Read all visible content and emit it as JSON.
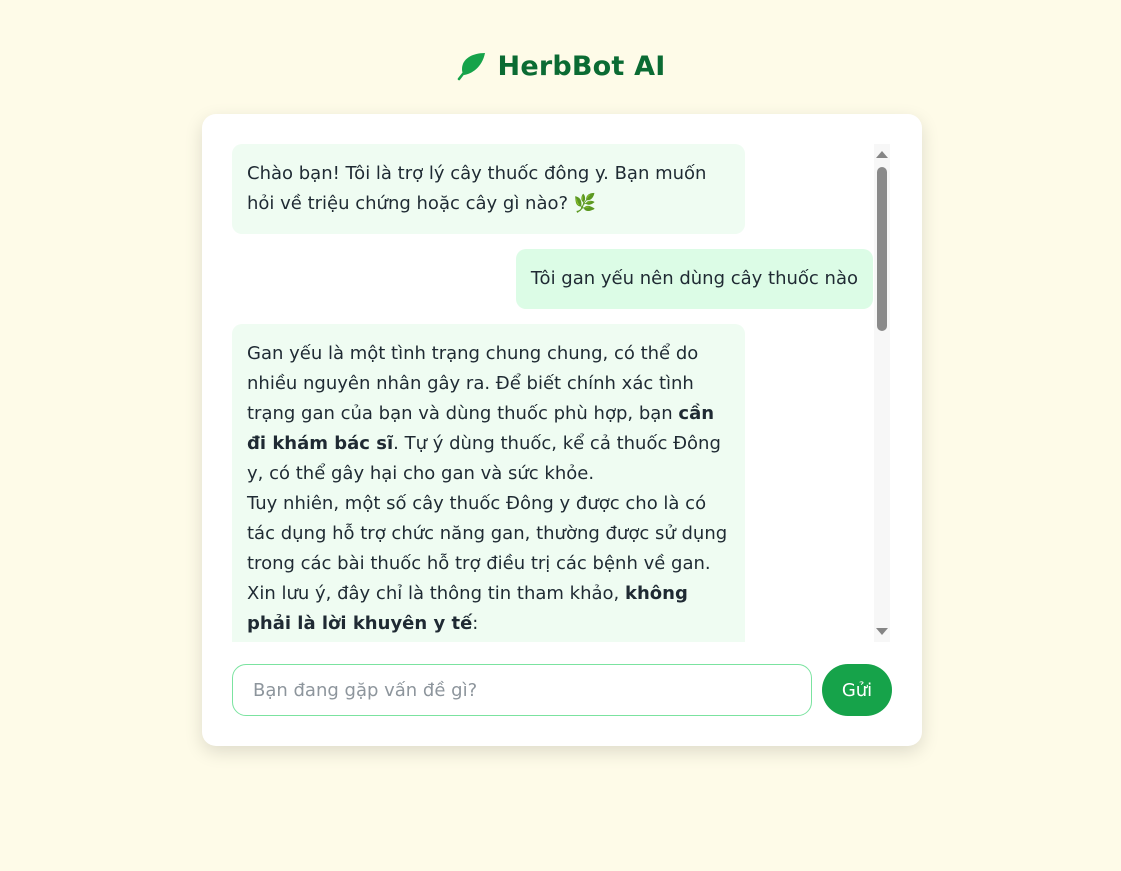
{
  "app": {
    "title": "HerbBot AI",
    "logo_icon": "leaf-icon",
    "brand_color": "#0b6b33",
    "background_color": "#fefbe8"
  },
  "messages": [
    {
      "role": "bot",
      "lines": [
        "Chào bạn! Tôi là trợ lý cây thuốc đông y. Bạn muốn hỏi về triệu chứng hoặc cây gì nào? 🌿"
      ]
    },
    {
      "role": "user",
      "text": "Tôi gan yếu nên dùng cây thuốc nào"
    },
    {
      "role": "bot",
      "p1_a": "Gan yếu là một tình trạng chung chung, có thể do nhiều nguyên nhân gây ra. Để biết chính xác tình trạng gan của bạn và dùng thuốc phù hợp, bạn ",
      "p1_b": "cần đi khám bác sĩ",
      "p1_c": ". Tự ý dùng thuốc, kể cả thuốc Đông y, có thể gây hại cho gan và sức khỏe.",
      "p2": "Tuy nhiên, một số cây thuốc Đông y được cho là có tác dụng hỗ trợ chức năng gan, thường được sử dụng trong các bài thuốc hỗ trợ điều trị các bệnh về gan.",
      "p3_a": "Xin lưu ý, đây chỉ là thông tin tham khảo, ",
      "p3_b": "không phải là lời khuyên y tế",
      "p3_c": ":"
    }
  ],
  "composer": {
    "placeholder": "Bạn đang gặp vấn đề gì?",
    "value": "",
    "send_label": "Gửi",
    "accent_color": "#16a34a"
  }
}
